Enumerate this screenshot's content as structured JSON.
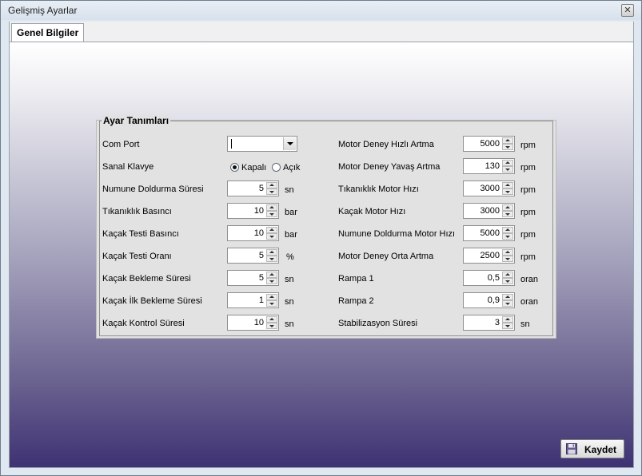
{
  "window": {
    "title": "Gelişmiş Ayarlar",
    "close_glyph": "✕"
  },
  "tabs": [
    {
      "label": "Genel Bilgiler"
    }
  ],
  "group": {
    "title": "Ayar Tanımları"
  },
  "left": {
    "com_port": {
      "label": "Com Port",
      "value": ""
    },
    "sanal_klavye": {
      "label": "Sanal Klavye",
      "options": [
        "Kapalı",
        "Açık"
      ],
      "selected": "Kapalı"
    },
    "rows": [
      {
        "label": "Numune Doldurma Süresi",
        "value": "5",
        "unit": "sn"
      },
      {
        "label": "Tıkanıklık Basıncı",
        "value": "10",
        "unit": "bar"
      },
      {
        "label": "Kaçak Testi Basıncı",
        "value": "10",
        "unit": "bar"
      },
      {
        "label": "Kaçak Testi Oranı",
        "value": "5",
        "unit": "%"
      },
      {
        "label": "Kaçak Bekleme Süresi",
        "value": "5",
        "unit": "sn"
      },
      {
        "label": "Kaçak İlk Bekleme Süresi",
        "value": "1",
        "unit": "sn"
      },
      {
        "label": "Kaçak Kontrol Süresi",
        "value": "10",
        "unit": "sn"
      }
    ]
  },
  "right": {
    "rows": [
      {
        "label": "Motor Deney Hızlı Artma",
        "value": "5000",
        "unit": "rpm"
      },
      {
        "label": "Motor Deney Yavaş Artma",
        "value": "130",
        "unit": "rpm"
      },
      {
        "label": "Tıkanıklık Motor Hızı",
        "value": "3000",
        "unit": "rpm"
      },
      {
        "label": "Kaçak Motor Hızı",
        "value": "3000",
        "unit": "rpm"
      },
      {
        "label": "Numune Doldurma Motor Hızı",
        "value": "5000",
        "unit": "rpm"
      },
      {
        "label": "Motor Deney Orta Artma",
        "value": "2500",
        "unit": "rpm"
      },
      {
        "label": "Rampa 1",
        "value": "0,5",
        "unit": "oran"
      },
      {
        "label": "Rampa 2",
        "value": "0,9",
        "unit": "oran"
      },
      {
        "label": "Stabilizasyon Süresi",
        "value": "3",
        "unit": "sn"
      }
    ]
  },
  "footer": {
    "save_label": "Kaydet",
    "save_icon": "floppy-disk-icon"
  }
}
